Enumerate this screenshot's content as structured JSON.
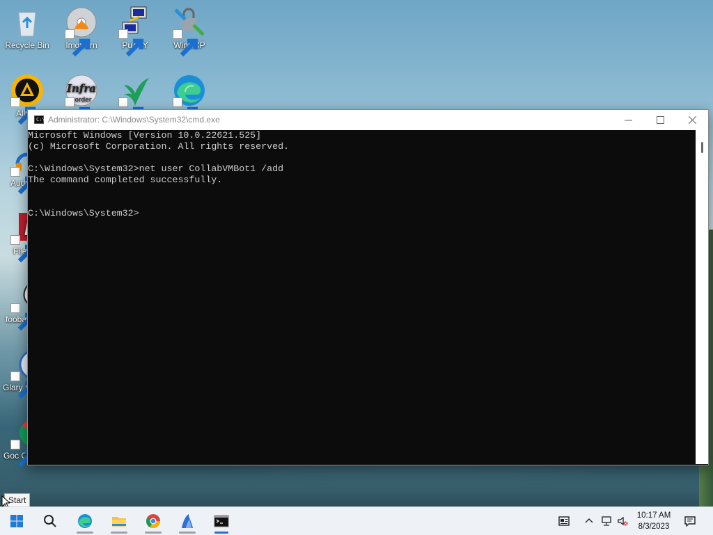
{
  "desktop": {
    "icons": [
      {
        "label": "Recycle Bin"
      },
      {
        "label": "ImgBurn"
      },
      {
        "label": "PuTTY"
      },
      {
        "label": "WinSCP"
      },
      {
        "label": "All"
      },
      {
        "label": "Infra corder"
      },
      {
        "label": ""
      },
      {
        "label": ""
      },
      {
        "label": "Aud"
      },
      {
        "label": "File"
      },
      {
        "label": "fooba"
      },
      {
        "label": "Glary U"
      },
      {
        "label": "Goc Chrome"
      }
    ]
  },
  "window": {
    "title": "Administrator: C:\\Windows\\System32\\cmd.exe",
    "console_lines": [
      "Microsoft Windows [Version 10.0.22621.525]",
      "(c) Microsoft Corporation. All rights reserved.",
      "",
      "C:\\Windows\\System32>net user CollabVMBot1 /add",
      "The command completed successfully.",
      "",
      "",
      "C:\\Windows\\System32>"
    ]
  },
  "tooltip": {
    "text": "Start"
  },
  "taskbar": {
    "apps": [
      "start-icon",
      "search-icon",
      "edge-icon",
      "file-explorer-icon",
      "chrome-icon",
      "app-icon",
      "cmd-icon"
    ],
    "clock": {
      "time": "10:17 AM",
      "date": "8/3/2023"
    }
  },
  "colors": {
    "accent": "#2b6cd1",
    "console_bg": "#0c0c0c",
    "console_fg": "#cccccc"
  }
}
